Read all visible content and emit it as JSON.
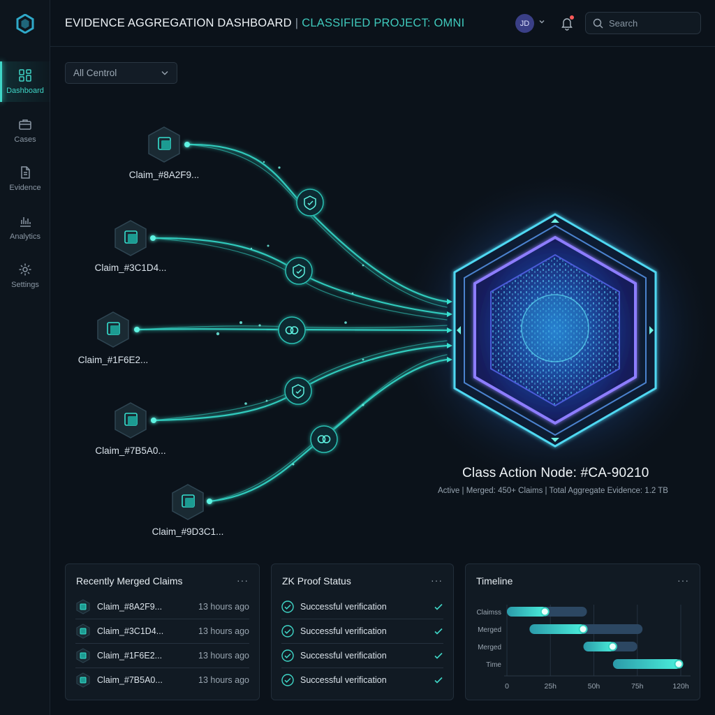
{
  "sidebar": {
    "items": [
      {
        "label": "Dashboard",
        "icon": "dashboard-icon",
        "active": true
      },
      {
        "label": "Cases",
        "icon": "briefcase-icon",
        "active": false
      },
      {
        "label": "Evidence",
        "icon": "document-icon",
        "active": false
      },
      {
        "label": "Analytics",
        "icon": "bar-chart-icon",
        "active": false
      },
      {
        "label": "Settings",
        "icon": "gear-icon",
        "active": false
      }
    ]
  },
  "header": {
    "title": "EVIDENCE AGGREGATION DASHBOARD",
    "separator": "|",
    "subtitle": "CLASSIFIED PROJECT: OMNI",
    "user_initials": "JD",
    "search_placeholder": "Search"
  },
  "filter": {
    "selected": "All Centrol"
  },
  "graph": {
    "claims": [
      "Claim_#8A2F9...",
      "Claim_#3C1D4...",
      "Claim_#1F6E2...",
      "Claim_#7B5A0...",
      "Claim_#9D3C1..."
    ],
    "hub_title": "Class Action Node: #CA-90210",
    "hub_subtitle": "Active | Merged: 450+ Claims | Total Aggregate Evidence: 1.2 TB"
  },
  "panels": {
    "recent": {
      "title": "Recently Merged Claims",
      "menu": "···",
      "rows": [
        {
          "name": "Claim_#8A2F9...",
          "time": "13 hours ago"
        },
        {
          "name": "Claim_#3C1D4...",
          "time": "13 hours ago"
        },
        {
          "name": "Claim_#1F6E2...",
          "time": "13 hours ago"
        },
        {
          "name": "Claim_#7B5A0...",
          "time": "13 hours ago"
        }
      ]
    },
    "zk": {
      "title": "ZK Proof Status",
      "menu": "···",
      "rows": [
        {
          "status": "Successful verification"
        },
        {
          "status": "Successful verification"
        },
        {
          "status": "Successful verification"
        },
        {
          "status": "Successful verification"
        }
      ]
    },
    "timeline": {
      "title": "Timeline",
      "menu": "···"
    }
  },
  "chart_data": {
    "type": "bar",
    "subtype": "gantt",
    "categories": [
      "Claimss",
      "Merged",
      "Merged",
      "Time"
    ],
    "x_ticks": [
      "0",
      "25h",
      "50h",
      "75h",
      "120h"
    ],
    "tasks": [
      {
        "label": "Claimss",
        "start": 0,
        "end": 46,
        "progress_end": 23
      },
      {
        "label": "Merged",
        "start": 13,
        "end": 78,
        "progress_end": 45
      },
      {
        "label": "Merged",
        "start": 44,
        "end": 75,
        "progress_end": 62
      },
      {
        "label": "Time",
        "start": 61,
        "end": 100,
        "progress_end": 100
      }
    ],
    "grid": true,
    "colors": {
      "track": "#2c4762",
      "fill": "#35d4c2"
    }
  },
  "colors": {
    "accent": "#3fd6c7",
    "background": "#0b121a",
    "hub_glow": "#7a5cff"
  }
}
